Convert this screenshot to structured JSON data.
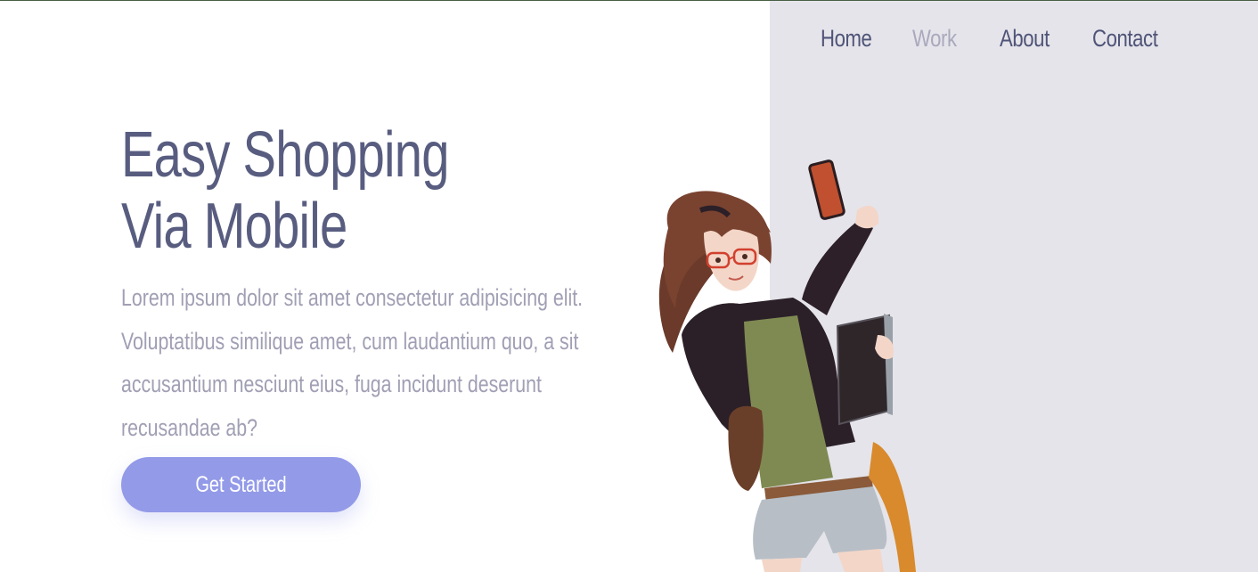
{
  "nav": {
    "items": [
      {
        "label": "Home"
      },
      {
        "label": "Work"
      },
      {
        "label": "About"
      },
      {
        "label": "Contact"
      }
    ],
    "active": "Work"
  },
  "hero": {
    "title_line1": "Easy Shopping",
    "title_line2": "Via Mobile",
    "description": "Lorem ipsum dolor sit amet consectetur adipisicing elit. Voluptatibus similique amet, cum laudantium quo, a sit accusantium nesciunt eius, fuga incidunt deserunt recusandae ab?",
    "cta_label": "Get Started"
  },
  "illustration": {
    "icon": "anime-girl-selfie-illustration"
  },
  "colors": {
    "heading": "#585d80",
    "nav_text": "#4f5478",
    "nav_active": "#a9a9bd",
    "body_text": "#a09fb4",
    "button": "#939ae8",
    "panel": "#e5e4ea"
  }
}
